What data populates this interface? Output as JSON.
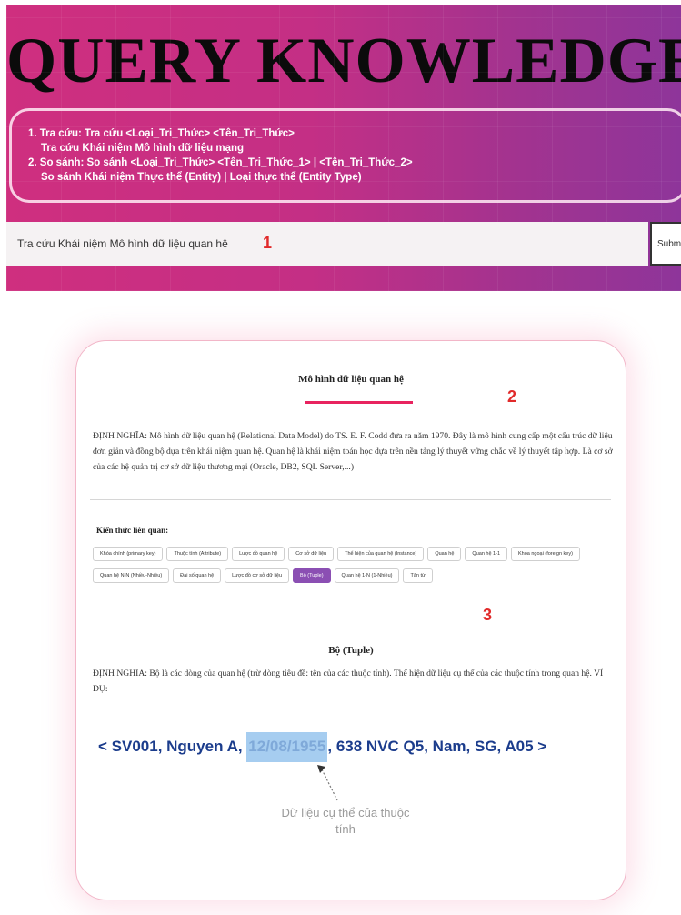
{
  "header": {
    "title": "QUERY KNOWLEDGE",
    "guide": [
      "1. Tra cứu: Tra cứu <Loại_Tri_Thức> <Tên_Tri_Thức>",
      "Tra cứu Khái niệm Mô hình dữ liệu mạng",
      "2. So sánh: So sánh <Loại_Tri_Thức> <Tên_Tri_Thức_1> | <Tên_Tri_Thức_2>",
      "So sánh Khái niệm Thực thể (Entity) | Loại thực thể (Entity Type)"
    ],
    "query_value": "Tra cứu Khái niệm Mô hình dữ liệu quan hệ",
    "submit_label": "Submit"
  },
  "markers": {
    "m1": "1",
    "m2": "2",
    "m3": "3"
  },
  "colors": {
    "accent": "#e8235f",
    "active_tag": "#8b4fb3",
    "tuple_text": "#1b3c8c",
    "highlight": "#a6cdf0"
  },
  "result": {
    "title": "Mô hình dữ liệu quan hệ",
    "definition": "ĐỊNH NGHĨA: Mô hình dữ liệu quan hệ (Relational Data Model) do TS. E. F. Codd đưa ra năm 1970. Đây là mô hình cung cấp một cấu trúc dữ liệu đơn giản và đồng bộ dựa trên khái niệm quan hệ. Quan hệ là khái niệm toán học dựa trên nền tảng lý thuyết vững chắc về lý thuyết tập hợp. Là cơ sở của các hệ quản trị cơ sở dữ liệu thương mại (Oracle, DB2, SQL Server,...)",
    "related_label": "Kiến thức liên quan:",
    "tags": [
      "Khóa chính (primary key)",
      "Thuộc tính (Attribute)",
      "Lược đồ quan hệ",
      "Cơ sở dữ liệu",
      "Thể hiện của quan hệ (Instance)",
      "Quan hệ",
      "Quan hệ 1-1",
      "Khóa ngoại (foreign key)",
      "Quan hệ N-N (Nhiều-Nhiều)",
      "Đại số quan hệ",
      "Lược đồ cơ sở dữ liệu",
      "Bộ (Tuple)",
      "Quan hệ 1-N (1-Nhiều)",
      "Tân từ"
    ],
    "active_tag_index": 11,
    "sub_title": "Bộ (Tuple)",
    "sub_definition": "ĐỊNH NGHĨA: Bộ là các dòng của quan hệ (trừ dòng tiêu đề: tên của các thuộc tính). Thể hiện dữ liệu cụ thể của các thuộc tính trong quan hệ. VÍ DỤ:",
    "tuple": {
      "open": "< SV001, Nguyen A, ",
      "highlight": "12/08/1955",
      "close": ", 638 NVC Q5, Nam, SG, A05 >"
    },
    "note": "Dữ liệu cụ thể của thuộc tính"
  }
}
